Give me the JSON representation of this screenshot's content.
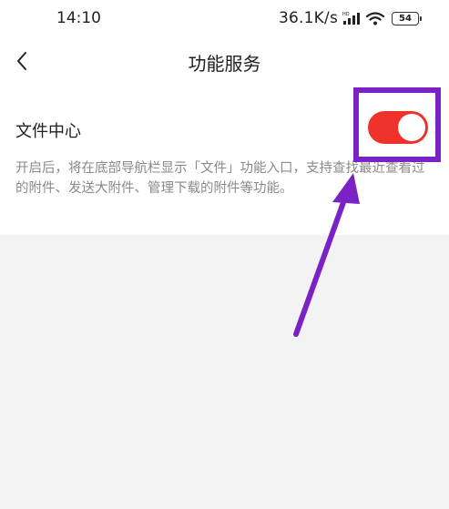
{
  "status_bar": {
    "time": "14:10",
    "net_speed": "36.1K/s",
    "hd_label": "HD",
    "battery": "54"
  },
  "nav": {
    "back_icon": "chevron-left-icon",
    "title": "功能服务"
  },
  "setting": {
    "title": "文件中心",
    "toggle_on": true,
    "description": "开启后，将在底部导航栏显示「文件」功能入口，支持查找最近查看过的附件、发送大附件、管理下载的附件等功能。"
  },
  "colors": {
    "toggle_accent": "#f0322d",
    "annotation": "#7b22c6",
    "background": "#f3f3f3"
  }
}
